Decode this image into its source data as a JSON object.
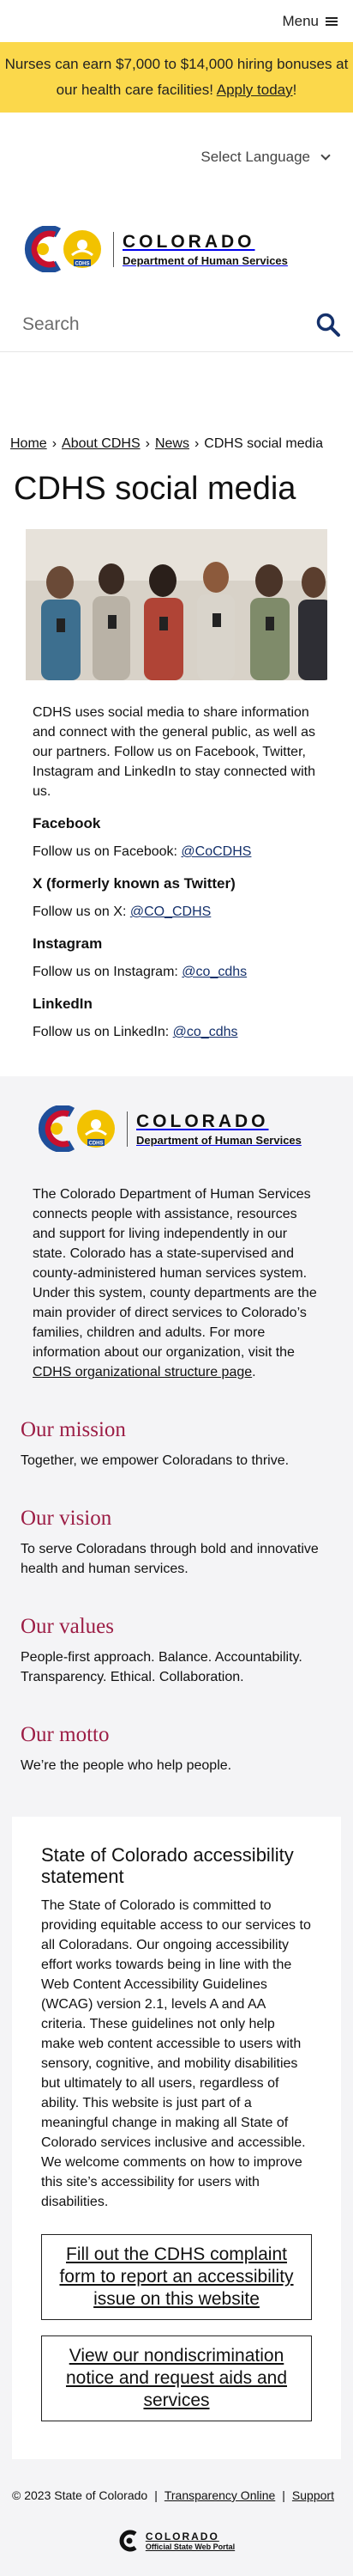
{
  "header": {
    "menu_label": "Menu"
  },
  "alert": {
    "text": "Nurses can earn $7,000 to $14,000 hiring bonuses at our health care facilities! ",
    "link": "Apply today",
    "suffix": "!"
  },
  "language": {
    "label": "Select Language"
  },
  "brand": {
    "state": "COLORADO",
    "department": "Department of Human Services",
    "badge": "CDHS"
  },
  "search": {
    "placeholder": "Search"
  },
  "breadcrumbs": [
    "Home",
    "About CDHS",
    "News",
    "CDHS social media"
  ],
  "page": {
    "title": "CDHS social media",
    "intro": "CDHS uses social media to share information and connect with the general public, as well as our partners. Follow us on Facebook, Twitter, Instagram and LinkedIn to stay connected with us.",
    "channels": [
      {
        "heading": "Facebook",
        "text": "Follow us on Facebook: ",
        "handle": "@CoCDHS"
      },
      {
        "heading": "X (formerly known as Twitter)",
        "text": "Follow us on X: ",
        "handle": "@CO_CDHS"
      },
      {
        "heading": "Instagram",
        "text": "Follow us on Instagram: ",
        "handle": "@co_cdhs"
      },
      {
        "heading": "LinkedIn",
        "text": "Follow us on LinkedIn: ",
        "handle": "@co_cdhs"
      }
    ]
  },
  "footer": {
    "about": "The Colorado Department of Human Services connects people with assistance, resources and support for living independently in our state. Colorado has a state-supervised and county-administered human services system. Under this system, county departments are the main provider of direct services to Colorado’s families, children and adults. For more information about our organization, visit the ",
    "about_link": "CDHS organizational structure page",
    "about_end": ".",
    "mission": {
      "heading": "Our mission",
      "text": "Together, we empower Coloradans to thrive."
    },
    "vision": {
      "heading": "Our vision",
      "text": "To serve Coloradans through bold and innovative health and human services."
    },
    "values": {
      "heading": "Our values",
      "text": "People-first approach. Balance. Accountability. Transparency. Ethical. Collaboration."
    },
    "motto": {
      "heading": "Our motto",
      "text": "We’re the people who help people."
    },
    "accessibility": {
      "heading": "State of Colorado accessibility statement",
      "text": "The State of Colorado is committed to providing equitable access to our services to all Coloradans. Our ongoing accessibility effort works towards being in line with the Web Content Accessibility Guidelines (WCAG) version 2.1, levels A and AA criteria. These guidelines not only help make web content accessible to users with sensory, cognitive, and mobility disabilities but ultimately to all users, regardless of ability. This website is just part of a meaningful change in making all State of Colorado services inclusive and accessible. We welcome comments on how to improve this site’s accessibility for users with disabilities.",
      "button1": "Fill out the CDHS complaint form to report an accessibility issue on this website",
      "button2": "View our nondiscrimination notice and request aids and services"
    },
    "copyright": "© 2023 State of Colorado",
    "links": [
      "Transparency Online",
      "Support"
    ],
    "portal": {
      "name": "COLORADO",
      "sub": "Official State Web Portal"
    }
  },
  "colors": {
    "alert_bg": "#fbd84b",
    "accent_red": "#9c1d45",
    "link_blue": "#15316b",
    "search_icon": "#15316b"
  }
}
